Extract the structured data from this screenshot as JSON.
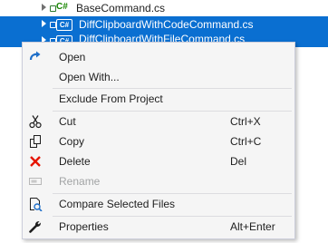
{
  "tree": {
    "files": [
      {
        "name": "BaseCommand.cs",
        "icon": "csharp-file-icon"
      },
      {
        "name": "DiffClipboardWithCodeCommand.cs",
        "icon": "csharp-class-file-icon"
      },
      {
        "name": "DiffClipboardWithFileCommand.cs",
        "icon": "csharp-class-file-icon"
      }
    ],
    "cs_label": "C#",
    "cs_box_label": "C#"
  },
  "menu": {
    "items": [
      {
        "label": "Open",
        "icon": "open-arrow-icon"
      },
      {
        "label": "Open With...",
        "icon": ""
      },
      {
        "label": "Exclude From Project",
        "icon": ""
      },
      {
        "label": "Cut",
        "shortcut": "Ctrl+X",
        "icon": "scissors-icon"
      },
      {
        "label": "Copy",
        "shortcut": "Ctrl+C",
        "icon": "copy-icon"
      },
      {
        "label": "Delete",
        "shortcut": "Del",
        "icon": "delete-x-icon"
      },
      {
        "label": "Rename",
        "icon": "rename-icon",
        "disabled": true
      },
      {
        "label": "Compare Selected Files",
        "icon": "compare-icon"
      },
      {
        "label": "Properties",
        "shortcut": "Alt+Enter",
        "icon": "wrench-icon"
      }
    ]
  },
  "colors": {
    "selection": "#0a6fd1",
    "menu_bg": "#f5f5f5",
    "delete_red": "#e51400",
    "open_blue": "#1e6ec8"
  }
}
